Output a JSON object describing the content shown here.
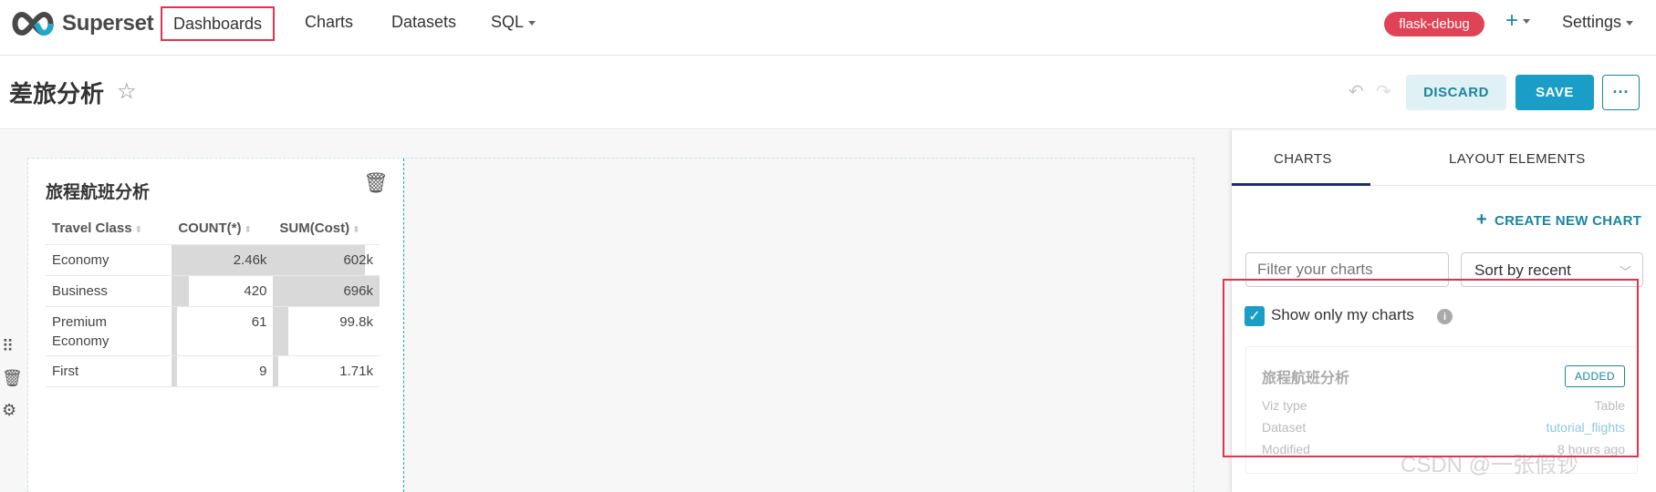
{
  "nav": {
    "brand": "Superset",
    "items": [
      "Dashboards",
      "Charts",
      "Datasets",
      "SQL"
    ],
    "env_badge": "flask-debug",
    "plus": "+",
    "settings": "Settings",
    "colors": {
      "accent": "#1a85a0",
      "badge": "#e04355",
      "highlight": "#e0334f"
    }
  },
  "header": {
    "title": "差旅分析",
    "discard": "DISCARD",
    "save": "SAVE",
    "more": "···",
    "undo_icon": "undo-icon",
    "redo_icon": "redo-icon"
  },
  "chart": {
    "title": "旅程航班分析",
    "columns": [
      "Travel Class",
      "COUNT(*)",
      "SUM(Cost)"
    ],
    "rows": [
      {
        "class": "Economy",
        "count": "2.46k",
        "sum": "602k",
        "count_frac": 1.0,
        "sum_frac": 0.86
      },
      {
        "class": "Business",
        "count": "420",
        "sum": "696k",
        "count_frac": 0.17,
        "sum_frac": 1.0
      },
      {
        "class": "Premium Economy",
        "count": "61",
        "sum": "99.8k",
        "count_frac": 0.025,
        "sum_frac": 0.14
      },
      {
        "class": "First",
        "count": "9",
        "sum": "1.71k",
        "count_frac": 0.004,
        "sum_frac": 0.002
      }
    ]
  },
  "panel": {
    "tabs": [
      "CHARTS",
      "LAYOUT ELEMENTS"
    ],
    "create_new": "CREATE NEW CHART",
    "filter_placeholder": "Filter your charts",
    "sort_value": "Sort by recent",
    "show_only_mine": "Show only my charts",
    "item": {
      "title": "旅程航班分析",
      "badge": "ADDED",
      "viz_type_label": "Viz type",
      "viz_type": "Table",
      "dataset_label": "Dataset",
      "dataset": "tutorial_flights",
      "modified_label": "Modified",
      "modified": "8 hours ago"
    }
  },
  "watermark": "CSDN @一张假钞"
}
